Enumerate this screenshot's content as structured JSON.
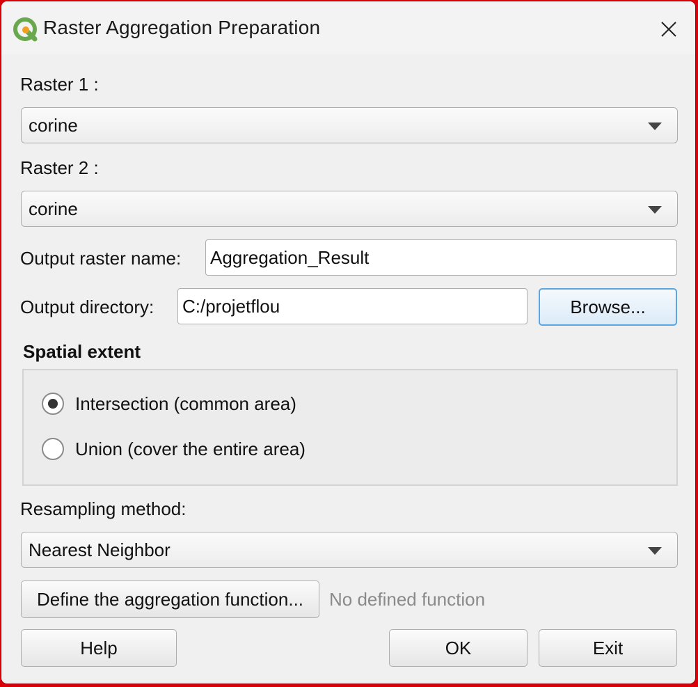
{
  "window": {
    "title": "Raster Aggregation Preparation",
    "app_icon": "qgis-logo-icon",
    "close_icon": "close-icon"
  },
  "raster1": {
    "label": "Raster 1 :",
    "value": "corine"
  },
  "raster2": {
    "label": "Raster 2 :",
    "value": "corine"
  },
  "output_name": {
    "label": "Output raster name:",
    "value": "Aggregation_Result"
  },
  "output_dir": {
    "label": "Output directory:",
    "value": "C:/projetflou",
    "browse_label": "Browse..."
  },
  "spatial_extent": {
    "title": "Spatial extent",
    "options": [
      {
        "label": "Intersection (common area)",
        "selected": true
      },
      {
        "label": "Union (cover the entire area)",
        "selected": false
      }
    ]
  },
  "resampling": {
    "label": "Resampling method:",
    "value": "Nearest Neighbor"
  },
  "aggregation": {
    "button_label": "Define the aggregation function...",
    "status": "No defined function"
  },
  "footer": {
    "help_label": "Help",
    "ok_label": "OK",
    "exit_label": "Exit"
  },
  "colors": {
    "accent": "#5ba6e0",
    "background": "#f0f0f0",
    "desktop": "#d9000a"
  }
}
